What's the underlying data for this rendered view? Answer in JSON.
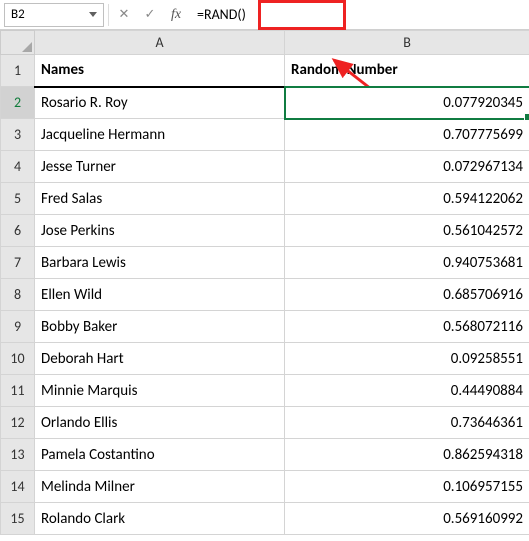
{
  "formula_bar": {
    "cell_ref": "B2",
    "cancel_icon": "✕",
    "confirm_icon": "✓",
    "fx_icon": "fx",
    "formula": "=RAND()"
  },
  "columns": {
    "a": "A",
    "b": "B"
  },
  "headers": {
    "names": "Names",
    "random": "Random Number"
  },
  "rows": [
    {
      "n": "1"
    },
    {
      "n": "2",
      "name": "Rosario R. Roy",
      "val": "0.077920345"
    },
    {
      "n": "3",
      "name": "Jacqueline Hermann",
      "val": "0.707775699"
    },
    {
      "n": "4",
      "name": "Jesse Turner",
      "val": "0.072967134"
    },
    {
      "n": "5",
      "name": "Fred Salas",
      "val": "0.594122062"
    },
    {
      "n": "6",
      "name": "Jose Perkins",
      "val": "0.561042572"
    },
    {
      "n": "7",
      "name": "Barbara Lewis",
      "val": "0.940753681"
    },
    {
      "n": "8",
      "name": "Ellen Wild",
      "val": "0.685706916"
    },
    {
      "n": "9",
      "name": "Bobby Baker",
      "val": "0.568072116"
    },
    {
      "n": "10",
      "name": "Deborah Hart",
      "val": "0.09258551"
    },
    {
      "n": "11",
      "name": "Minnie Marquis",
      "val": "0.44490884"
    },
    {
      "n": "12",
      "name": "Orlando Ellis",
      "val": "0.73646361"
    },
    {
      "n": "13",
      "name": "Pamela Costantino",
      "val": "0.862594318"
    },
    {
      "n": "14",
      "name": "Melinda Milner",
      "val": "0.106957155"
    },
    {
      "n": "15",
      "name": "Rolando Clark",
      "val": "0.569160992"
    }
  ]
}
